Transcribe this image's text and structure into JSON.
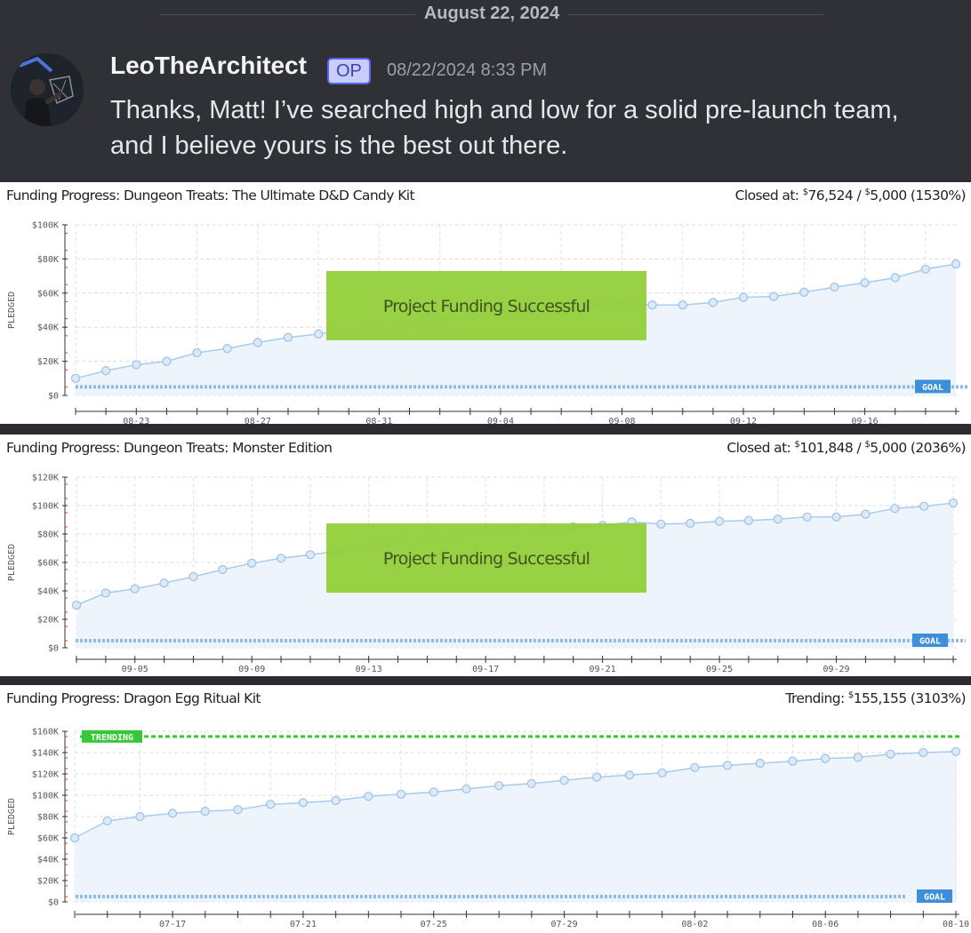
{
  "message": {
    "date_divider": "August 22, 2024",
    "username": "LeoTheArchitect",
    "badge": "OP",
    "timestamp": "08/22/2024 8:33 PM",
    "text_line1": "Thanks, Matt!  I’ve searched high and low for a solid pre-launch team,",
    "text_line2": "and I believe yours is the best out there."
  },
  "colors": {
    "line": "#a9cbec",
    "fill": "#eef4fc",
    "goal": "#8fbbe4",
    "goal_badge": "#3c8fd8",
    "trending": "#37c837",
    "success_box": "#94cf3b",
    "discord_bg": "#2f3136"
  },
  "chart_data": [
    {
      "type": "area",
      "title": "Funding Progress: Dungeon Treats: The Ultimate D&D Candy Kit",
      "status_label": "Closed at:",
      "pledged": "76,524",
      "goal": "5,000",
      "percent": "(1530%)",
      "ylabel": "PLEDGED",
      "ylim": [
        0,
        100000
      ],
      "yticks": [
        "$0",
        "$20K",
        "$40K",
        "$60K",
        "$80K",
        "$100K"
      ],
      "xticks": [
        "08-23",
        "08-27",
        "08-31",
        "09-04",
        "09-08",
        "09-12",
        "09-16"
      ],
      "xtick_index": [
        2,
        6,
        10,
        14,
        18,
        22,
        26
      ],
      "values": [
        10000,
        14500,
        18000,
        20000,
        25000,
        27500,
        31000,
        34000,
        36000,
        38500,
        39500,
        42000,
        44000,
        46000,
        48500,
        50500,
        52000,
        53000,
        53000,
        53000,
        53000,
        54500,
        57500,
        58000,
        60500,
        63500,
        66000,
        69000,
        74000,
        77000
      ],
      "goal_value": 5000,
      "goal_badge": "GOAL",
      "overlay": "Project Funding Successful"
    },
    {
      "type": "area",
      "title": "Funding Progress: Dungeon Treats: Monster Edition",
      "status_label": "Closed at:",
      "pledged": "101,848",
      "goal": "5,000",
      "percent": "(2036%)",
      "ylabel": "PLEDGED",
      "ylim": [
        0,
        120000
      ],
      "yticks": [
        "$0",
        "$20K",
        "$40K",
        "$60K",
        "$80K",
        "$100K",
        "$120K"
      ],
      "xticks": [
        "09-05",
        "09-09",
        "09-13",
        "09-17",
        "09-21",
        "09-25",
        "09-29"
      ],
      "xtick_index": [
        2,
        6,
        10,
        14,
        18,
        22,
        26
      ],
      "values": [
        30000,
        38500,
        41500,
        45500,
        50000,
        55000,
        59500,
        63000,
        65500,
        68000,
        72000,
        75000,
        76500,
        79000,
        81500,
        83000,
        83500,
        85000,
        86000,
        88500,
        87000,
        87500,
        89000,
        89500,
        90500,
        92000,
        92000,
        94000,
        98000,
        99500,
        101800
      ],
      "goal_value": 5000,
      "goal_badge": "GOAL",
      "overlay": "Project Funding Successful"
    },
    {
      "type": "area",
      "title": "Funding Progress: Dragon Egg Ritual Kit",
      "status_label": "Trending:",
      "pledged": "155,155",
      "percent": "(3103%)",
      "ylabel": "PLEDGED",
      "ylim": [
        0,
        160000
      ],
      "yticks": [
        "$0",
        "$20K",
        "$40K",
        "$60K",
        "$80K",
        "$100K",
        "$120K",
        "$140K",
        "$160K"
      ],
      "xticks": [
        "07-17",
        "07-21",
        "07-25",
        "07-29",
        "08-02",
        "08-06",
        "08-10"
      ],
      "xtick_index": [
        3,
        7,
        11,
        15,
        19,
        23,
        27
      ],
      "values": [
        60000,
        76000,
        80000,
        83000,
        85000,
        86500,
        91500,
        93000,
        95000,
        99000,
        101000,
        103000,
        106000,
        109000,
        111000,
        114000,
        117000,
        119000,
        121000,
        126000,
        128000,
        130000,
        132000,
        134500,
        135500,
        138500,
        140000,
        141000
      ],
      "goal_value": 5000,
      "goal_badge": "GOAL",
      "trend_value": 155155,
      "trend_badge": "TRENDING"
    }
  ]
}
